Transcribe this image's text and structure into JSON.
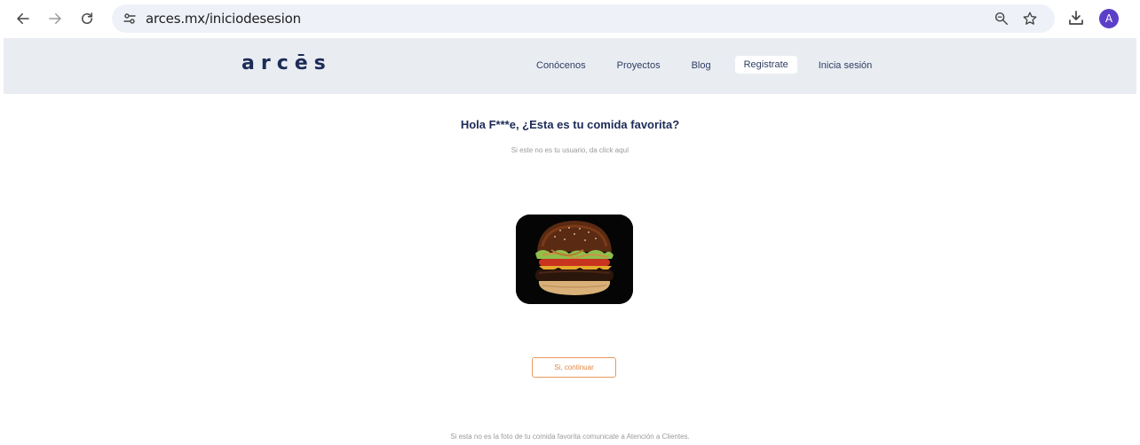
{
  "browser": {
    "url": "arces.mx/iniciodesesion",
    "profile_initial": "A"
  },
  "site": {
    "logo": "arcēs",
    "nav": [
      {
        "label": "Conócenos"
      },
      {
        "label": "Proyectos"
      },
      {
        "label": "Blog"
      },
      {
        "label": "Registrate"
      },
      {
        "label": "Inicia sesión"
      }
    ]
  },
  "main": {
    "greeting": "Hola F***e, ¿Esta es tu comida favorita?",
    "not_user_link": "Si este no es tu usuario, da click aquí",
    "continue_label": "Si, continuar",
    "footer_note": "Si esta no es la foto de tu comida favorita comunicate a Atención a Clientes."
  },
  "colors": {
    "brand_navy": "#1d2b57",
    "header_bg": "#e9edf2",
    "accent_orange": "#e08443",
    "avatar": "#5b3fc8"
  }
}
